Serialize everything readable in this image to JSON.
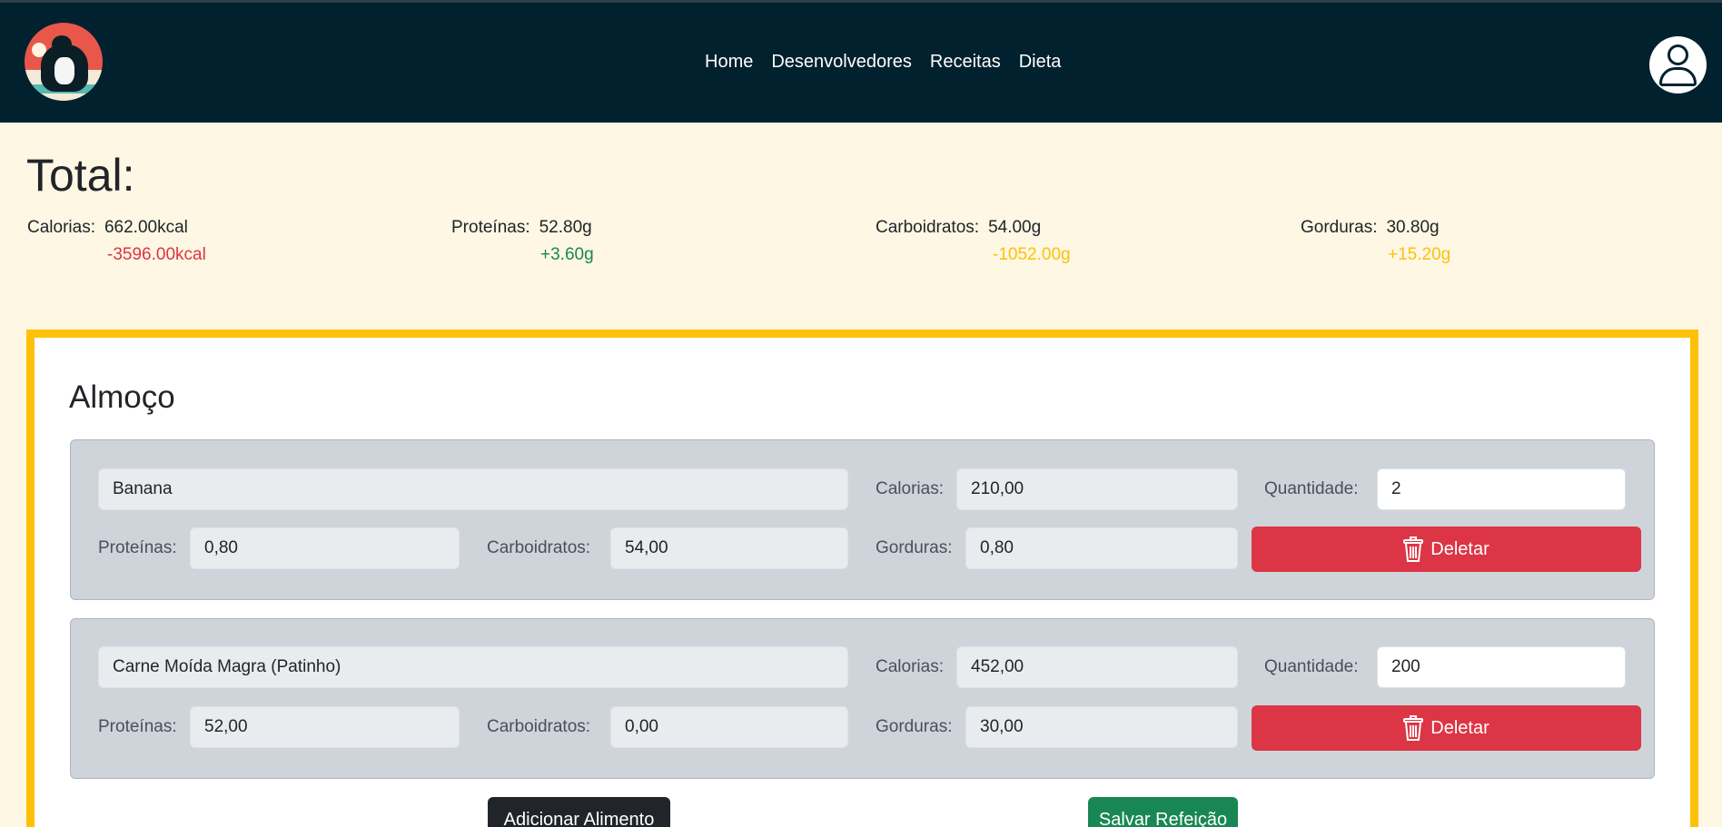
{
  "nav": {
    "logo_icon": "penguin-bodybuilder-logo",
    "links": [
      "Home",
      "Desenvolvedores",
      "Receitas",
      "Dieta"
    ],
    "avatar_icon": "user-icon"
  },
  "total": {
    "title": "Total:",
    "calorias": {
      "label": "Calorias:",
      "value": "662.00kcal",
      "diff": "-3596.00kcal",
      "diff_color": "#dc3545"
    },
    "proteinas": {
      "label": "Proteínas:",
      "value": "52.80g",
      "diff": "+3.60g",
      "diff_color": "#198754"
    },
    "carboidratos": {
      "label": "Carboidratos:",
      "value": "54.00g",
      "diff": "-1052.00g",
      "diff_color": "#ffc107"
    },
    "gorduras": {
      "label": "Gorduras:",
      "value": "30.80g",
      "diff": "+15.20g",
      "diff_color": "#ffc107"
    }
  },
  "meal": {
    "title": "Almoço",
    "labels": {
      "calorias": "Calorias:",
      "quantidade": "Quantidade:",
      "proteinas": "Proteínas:",
      "carboidratos": "Carboidratos:",
      "gorduras": "Gorduras:",
      "delete": "Deletar"
    },
    "foods": [
      {
        "name": "Banana",
        "calorias": "210,00",
        "quantidade": "2",
        "proteinas": "0,80",
        "carboidratos": "54,00",
        "gorduras": "0,80"
      },
      {
        "name": "Carne Moída Magra (Patinho)",
        "calorias": "452,00",
        "quantidade": "200",
        "proteinas": "52,00",
        "carboidratos": "0,00",
        "gorduras": "30,00"
      }
    ],
    "add_button": "Adicionar Alimento",
    "save_button": "Salvar Refeição"
  },
  "colors": {
    "navbar": "#01212e",
    "background": "#fdf7e4",
    "card_border": "#ffc107",
    "danger": "#dc3545",
    "success": "#198754",
    "dark": "#212529"
  }
}
